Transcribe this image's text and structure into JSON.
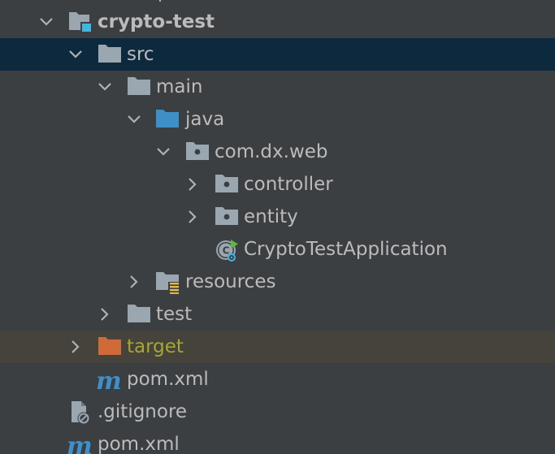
{
  "project_tree": {
    "root": {
      "label": "crypto-test"
    },
    "src": {
      "label": "src"
    },
    "main": {
      "label": "main"
    },
    "java": {
      "label": "java"
    },
    "package": {
      "label": "com.dx.web"
    },
    "controller": {
      "label": "controller"
    },
    "entity": {
      "label": "entity"
    },
    "application": {
      "label": "CryptoTestApplication"
    },
    "resources": {
      "label": "resources"
    },
    "test": {
      "label": "test"
    },
    "target": {
      "label": "target"
    },
    "module_pom": {
      "label": "pom.xml"
    },
    "gitignore": {
      "label": ".gitignore"
    },
    "root_pom": {
      "label": "pom.xml"
    }
  },
  "colors": {
    "background": "#3c3f41",
    "selection": "#0d293e",
    "excluded_row": "#45433b",
    "text": "#bbbbbb",
    "excluded_text": "#a7a730",
    "folder": "#9aa7b0",
    "source_folder": "#3d8fc6",
    "excluded_folder": "#d06a38",
    "maven": "#3f8fca"
  }
}
